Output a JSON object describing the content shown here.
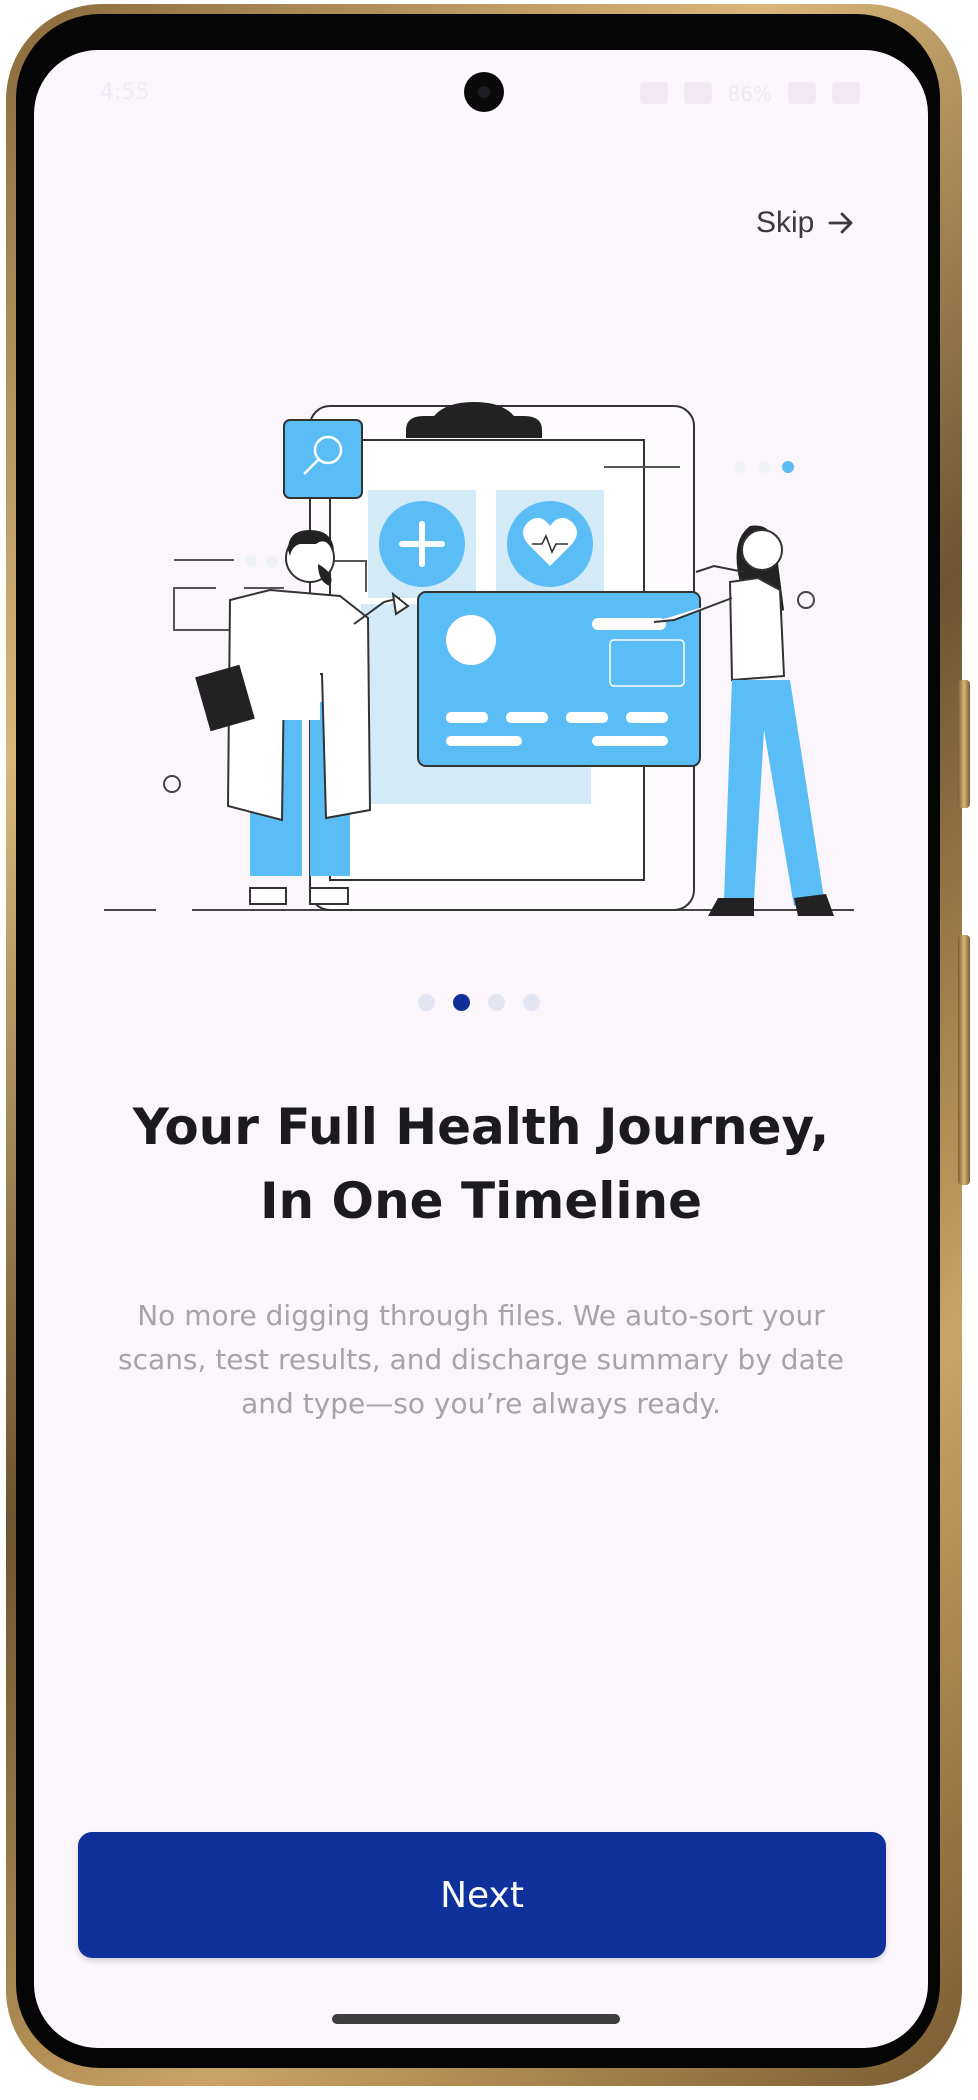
{
  "status_bar": {
    "time": "4:55",
    "battery": "86%"
  },
  "header": {
    "skip_label": "Skip",
    "skip_icon": "arrow-right-icon"
  },
  "illustration": {
    "name": "health-records-illustration",
    "accent_color": "#5bbdf5",
    "accent_light": "#d3eaf8"
  },
  "pager": {
    "count": 4,
    "active_index": 1
  },
  "content": {
    "title_line1": "Your Full Health Journey,",
    "title_line2": "In One Timeline",
    "description": "No more digging through files. We auto-sort your scans, test results, and discharge summary by date and type—so you’re always ready."
  },
  "footer": {
    "next_label": "Next"
  },
  "colors": {
    "background": "#fbf5fc",
    "primary": "#0e319c",
    "active_dot": "#0f2f97",
    "inactive_dot": "#e3e6f2",
    "title": "#1b1b1f",
    "body_text": "#a7a3aa"
  }
}
